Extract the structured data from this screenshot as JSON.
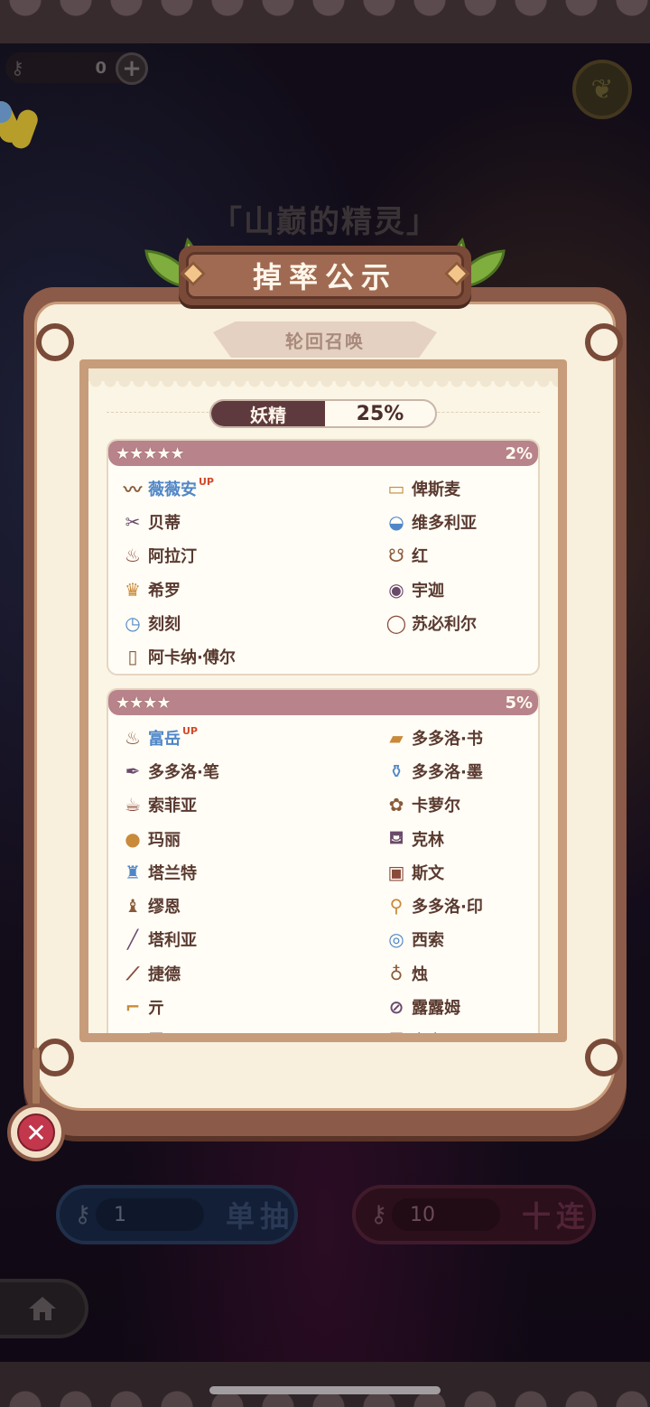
{
  "hud": {
    "key_count": "0",
    "plus_symbol": "+",
    "banner_title": "「山巅的精灵」"
  },
  "bottom": {
    "single_cost": "1",
    "single_label": "单抽",
    "ten_cost": "10",
    "ten_label": "十连"
  },
  "modal": {
    "title": "掉率公示",
    "subtitle": "轮回召唤",
    "category": {
      "name": "妖精",
      "rate": "25%"
    },
    "tiers": [
      {
        "stars": "★★★★★",
        "rate": "2%",
        "items": [
          {
            "name": "薇薇安",
            "up": true,
            "icon": "necklace-icon"
          },
          {
            "name": "俾斯麦",
            "up": false,
            "icon": "eraser-icon"
          },
          {
            "name": "贝蒂",
            "up": false,
            "icon": "scissors-icon"
          },
          {
            "name": "维多利亚",
            "up": false,
            "icon": "plate-icon"
          },
          {
            "name": "阿拉汀",
            "up": false,
            "icon": "lamp-icon"
          },
          {
            "name": "红",
            "up": false,
            "icon": "basket-icon"
          },
          {
            "name": "希罗",
            "up": false,
            "icon": "crown-icon"
          },
          {
            "name": "宇迦",
            "up": false,
            "icon": "cow-pattern-icon"
          },
          {
            "name": "刻刻",
            "up": false,
            "icon": "pocket-watch-icon"
          },
          {
            "name": "苏必利尔",
            "up": false,
            "icon": "ring-icon"
          },
          {
            "name": "阿卡纳·傅尔",
            "up": false,
            "icon": "tarot-card-icon"
          }
        ]
      },
      {
        "stars": "★★★★",
        "rate": "5%",
        "items": [
          {
            "name": "富岳",
            "up": true,
            "icon": "flame-pot-icon"
          },
          {
            "name": "多多洛·书",
            "up": false,
            "icon": "book-icon"
          },
          {
            "name": "多多洛·笔",
            "up": false,
            "icon": "quill-icon"
          },
          {
            "name": "多多洛·墨",
            "up": false,
            "icon": "inkwell-icon"
          },
          {
            "name": "索菲亚",
            "up": false,
            "icon": "teacup-icon"
          },
          {
            "name": "卡萝尔",
            "up": false,
            "icon": "lily-icon"
          },
          {
            "name": "玛丽",
            "up": false,
            "icon": "gourd-icon"
          },
          {
            "name": "克林",
            "up": false,
            "icon": "watering-can-icon"
          },
          {
            "name": "塔兰特",
            "up": false,
            "icon": "top-hat-icon"
          },
          {
            "name": "斯文",
            "up": false,
            "icon": "box-icon"
          },
          {
            "name": "缪恩",
            "up": false,
            "icon": "chess-piece-icon"
          },
          {
            "name": "多多洛·印",
            "up": false,
            "icon": "seal-stamp-icon"
          },
          {
            "name": "塔利亚",
            "up": false,
            "icon": "baton-icon"
          },
          {
            "name": "西索",
            "up": false,
            "icon": "tape-icon"
          },
          {
            "name": "捷德",
            "up": false,
            "icon": "needle-icon"
          },
          {
            "name": "烛",
            "up": false,
            "icon": "candle-icon"
          },
          {
            "name": "亓",
            "up": false,
            "icon": "high-heel-icon"
          },
          {
            "name": "露露姆",
            "up": false,
            "icon": "test-tube-icon"
          },
          {
            "name": "露西",
            "up": false,
            "icon": "bouquet-icon"
          },
          {
            "name": "斑斑",
            "up": false,
            "icon": "bag-icon"
          }
        ]
      }
    ],
    "up_badge": "UP"
  },
  "colors": {
    "board_brown": "#8c5a48",
    "paper": "#f8efdc",
    "tier_header": "#b8838a",
    "up_blue": "#4f86c8",
    "close_red": "#c2374c"
  }
}
